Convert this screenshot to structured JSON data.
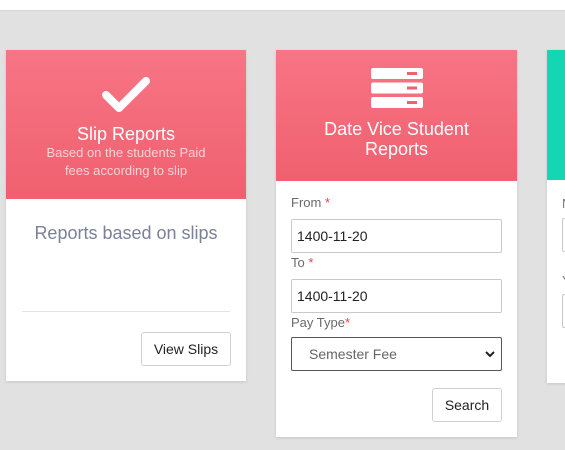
{
  "cards": [
    {
      "icon": "check-icon",
      "title": "Slip Reports",
      "subtitle": "Based on the students Paid fees according to slip",
      "body_text": "Reports based on slips",
      "button_label": "View Slips"
    },
    {
      "icon": "server-icon",
      "title": "Date Vice Student Reports",
      "form": {
        "from_label": "From ",
        "from_value": "1400-11-20",
        "to_label": "To ",
        "to_value": "1400-11-20",
        "pay_type_label": "Pay Type",
        "pay_type_selected": "Semester Fee",
        "required_marker": "*"
      },
      "button_label": "Search"
    },
    {
      "partial": true,
      "labels": [
        "N",
        "Y"
      ]
    }
  ],
  "colors": {
    "card_header": "#f0606f",
    "card3_header": "#15d6b3",
    "required": "#e8414f",
    "background": "#e1e1e1"
  }
}
